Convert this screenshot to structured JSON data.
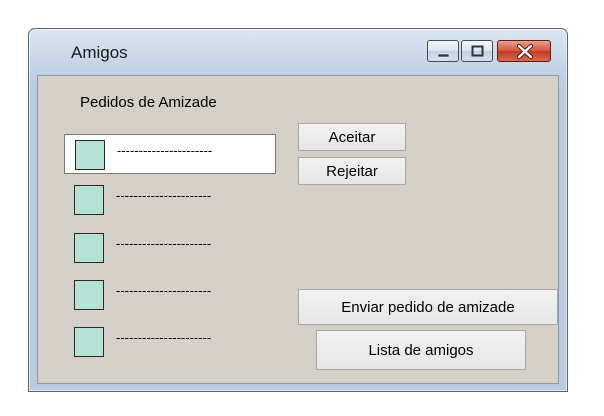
{
  "window": {
    "title": "Amigos"
  },
  "controls": {
    "minimize_icon": "minimize-icon",
    "maximize_icon": "maximize-icon",
    "close_icon": "close-icon"
  },
  "requests": {
    "label": "Pedidos de Amizade",
    "items": [
      {
        "name": "----------------------",
        "avatar": "avatar-placeholder",
        "selected": true
      },
      {
        "name": "----------------------",
        "avatar": "avatar-placeholder",
        "selected": false
      },
      {
        "name": "----------------------",
        "avatar": "avatar-placeholder",
        "selected": false
      },
      {
        "name": "----------------------",
        "avatar": "avatar-placeholder",
        "selected": false
      },
      {
        "name": "----------------------",
        "avatar": "avatar-placeholder",
        "selected": false
      }
    ]
  },
  "actions": {
    "accept_label": "Aceitar",
    "reject_label": "Rejeitar",
    "send_request_label": "Enviar pedido de amizade",
    "friends_list_label": "Lista de amigos"
  },
  "colors": {
    "avatar_fill": "#b4e2d4",
    "client_bg": "#d4d0c8",
    "close_button": "#c13a23"
  }
}
